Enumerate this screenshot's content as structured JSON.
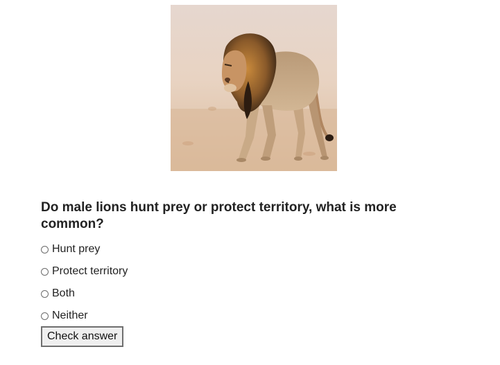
{
  "quiz": {
    "image_icon": "male-lion-photo",
    "question": "Do male lions hunt prey or protect territory, what is more common?",
    "options": [
      {
        "label": "Hunt prey",
        "selected": false
      },
      {
        "label": "Protect territory",
        "selected": false
      },
      {
        "label": "Both",
        "selected": false
      },
      {
        "label": "Neither",
        "selected": false
      }
    ],
    "check_label": "Check answer"
  }
}
